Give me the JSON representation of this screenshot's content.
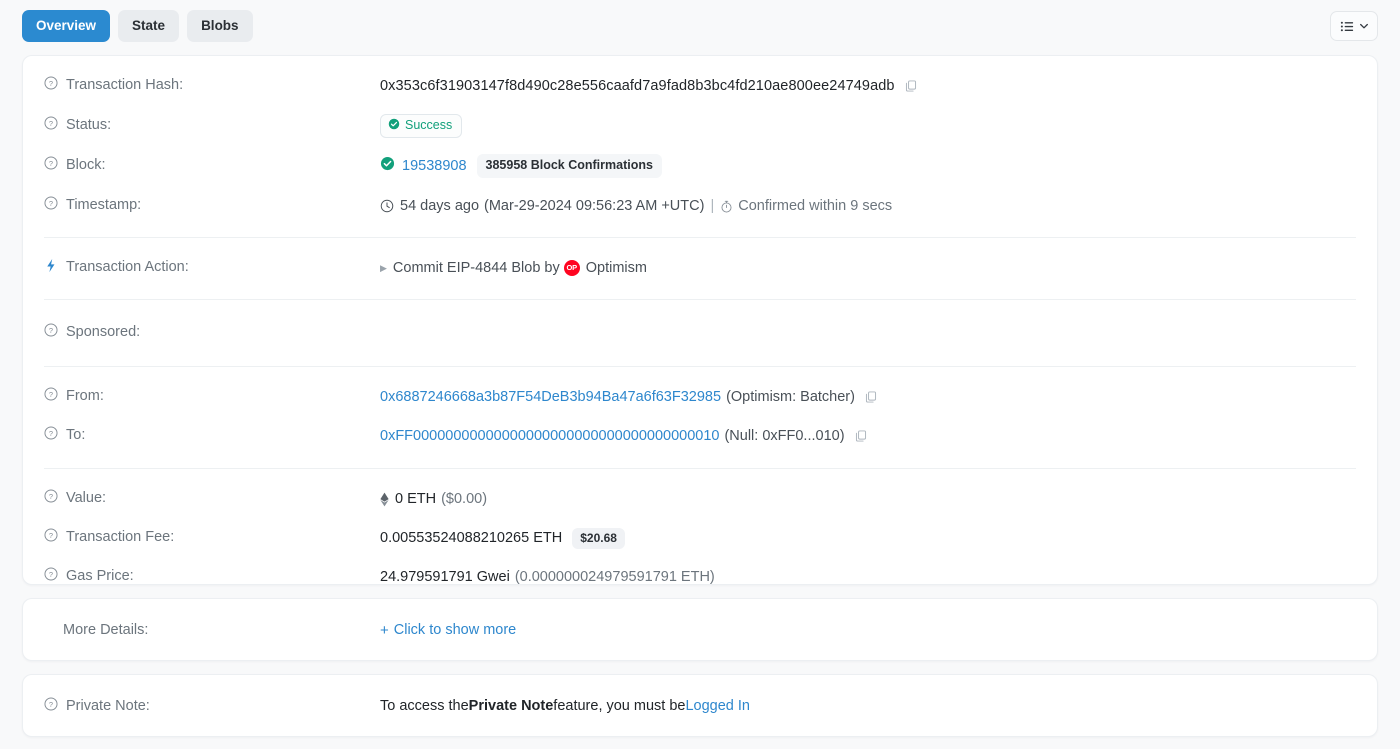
{
  "tabs": [
    {
      "label": "Overview",
      "active": true
    },
    {
      "label": "State",
      "active": false
    },
    {
      "label": "Blobs",
      "active": false
    }
  ],
  "toolbar": {
    "options_icon": "list-options-icon",
    "chevron": "chevron-down-icon"
  },
  "overview": {
    "tx_hash": {
      "label": "Transaction Hash:",
      "value": "0x353c6f31903147f8d490c28e556caafd7a9fad8b3bc4fd210ae800ee24749adb",
      "copy_icon": "copy-icon"
    },
    "status": {
      "label": "Status:",
      "badge": "Success",
      "badge_icon": "check-circle-icon",
      "color": "#12a07b"
    },
    "block": {
      "label": "Block:",
      "check_icon": "check-circle-icon",
      "number": "19538908",
      "confirmations": "385958 Block Confirmations"
    },
    "timestamp": {
      "label": "Timestamp:",
      "clock_icon": "clock-icon",
      "age": "54 days ago",
      "absolute": "(Mar-29-2024 09:56:23 AM +UTC)",
      "separator": "|",
      "stopwatch_icon": "stopwatch-icon",
      "confirmed": "Confirmed within 9 secs"
    },
    "action": {
      "label": "Transaction Action:",
      "icon": "lightning-bolt-icon",
      "caret": "caret-right-icon",
      "text_before": "Commit EIP-4844 Blob by",
      "brand_logo": "optimism-logo",
      "brand_logo_text": "OP",
      "brand": "Optimism"
    },
    "sponsored": {
      "label": "Sponsored:",
      "value": ""
    },
    "from": {
      "label": "From:",
      "address": "0x6887246668a3b87F54DeB3b94Ba47a6f63F32985",
      "tag": "(Optimism: Batcher)",
      "copy_icon": "copy-icon"
    },
    "to": {
      "label": "To:",
      "address": "0xFF00000000000000000000000000000000000010",
      "tag": "(Null: 0xFF0...010)",
      "copy_icon": "copy-icon"
    },
    "value": {
      "label": "Value:",
      "eth_icon": "ethereum-diamond-icon",
      "amount": "0 ETH",
      "fiat": "($0.00)"
    },
    "tx_fee": {
      "label": "Transaction Fee:",
      "amount": "0.00553524088210265 ETH",
      "fiat_badge": "$20.68"
    },
    "gas_price": {
      "label": "Gas Price:",
      "gwei": "24.979591791 Gwei",
      "eth": "(0.000000024979591791 ETH)"
    }
  },
  "more_details": {
    "label": "More Details:",
    "plus": "+",
    "link": "Click to show more"
  },
  "private_note": {
    "label": "Private Note:",
    "text_before": "To access the ",
    "bold": "Private Note",
    "text_after": " feature, you must be ",
    "link": "Logged In"
  },
  "colors": {
    "accent": "#2e87cd",
    "tab_active_bg": "#2b8ad0",
    "success": "#12a07b",
    "optimism_red": "#ff0420",
    "page_bg": "#f8f9fa",
    "muted_text": "#6c757d"
  }
}
